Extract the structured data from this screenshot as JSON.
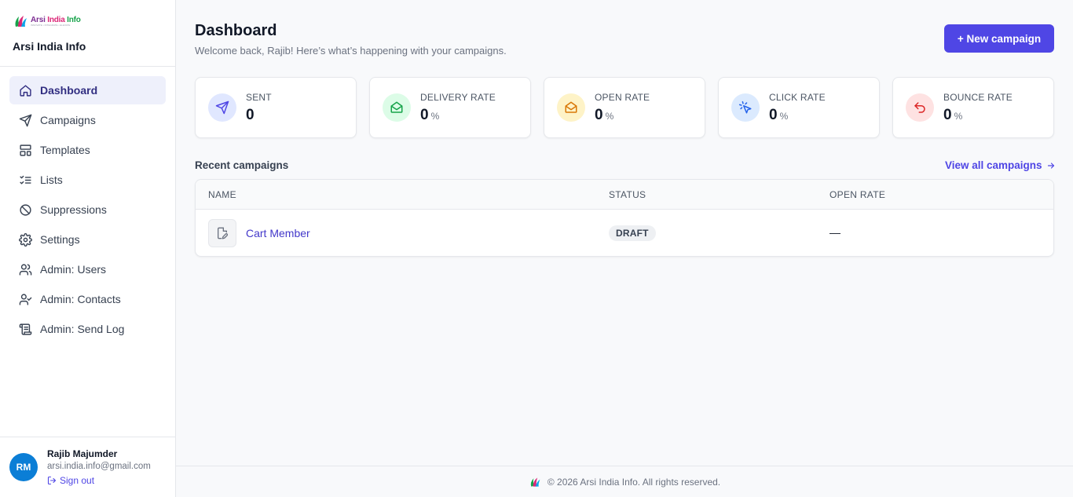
{
  "brand": {
    "logo_text_1": "Arsi ",
    "logo_text_2": "India ",
    "logo_text_3": "Info",
    "logo_tagline": "INNOVATE • INTEGRATE • ELEVATE",
    "name": "Arsi India Info"
  },
  "sidebar": {
    "items": [
      {
        "label": "Dashboard",
        "icon": "home-icon",
        "active": true
      },
      {
        "label": "Campaigns",
        "icon": "send-icon"
      },
      {
        "label": "Templates",
        "icon": "layout-icon"
      },
      {
        "label": "Lists",
        "icon": "list-checks-icon"
      },
      {
        "label": "Suppressions",
        "icon": "ban-icon"
      },
      {
        "label": "Settings",
        "icon": "gear-icon"
      },
      {
        "label": "Admin: Users",
        "icon": "users-icon"
      },
      {
        "label": "Admin: Contacts",
        "icon": "user-check-icon"
      },
      {
        "label": "Admin: Send Log",
        "icon": "scroll-icon"
      }
    ]
  },
  "user": {
    "initials": "RM",
    "name": "Rajib Majumder",
    "email": "arsi.india.info@gmail.com",
    "signout_label": "Sign out"
  },
  "header": {
    "title": "Dashboard",
    "subtitle": "Welcome back, Rajib! Here’s what’s happening with your campaigns.",
    "new_campaign_label": "+ New campaign"
  },
  "stats": [
    {
      "label": "SENT",
      "value": "0",
      "unit": "",
      "icon": "send-icon",
      "bg": "#e0e7ff",
      "color": "#4f46e5"
    },
    {
      "label": "DELIVERY RATE",
      "value": "0",
      "unit": "%",
      "icon": "mail-open-icon",
      "bg": "#dcfce7",
      "color": "#16a34a"
    },
    {
      "label": "OPEN RATE",
      "value": "0",
      "unit": "%",
      "icon": "mail-open-icon",
      "bg": "#fef3c7",
      "color": "#d97706"
    },
    {
      "label": "CLICK RATE",
      "value": "0",
      "unit": "%",
      "icon": "pointer-click-icon",
      "bg": "#dbeafe",
      "color": "#2563eb"
    },
    {
      "label": "BOUNCE RATE",
      "value": "0",
      "unit": "%",
      "icon": "undo-icon",
      "bg": "#fee2e2",
      "color": "#dc2626"
    }
  ],
  "recent": {
    "title": "Recent campaigns",
    "view_all_label": "View all campaigns",
    "columns": [
      "NAME",
      "STATUS",
      "OPEN RATE"
    ],
    "rows": [
      {
        "name": "Cart Member",
        "status": "DRAFT",
        "open_rate": "—",
        "icon": "file-edit-icon"
      }
    ]
  },
  "footer": {
    "text": "© 2026 Arsi India Info. All rights reserved."
  },
  "colors": {
    "accent": "#4f46e5",
    "avatar": "#0b7ed6"
  }
}
